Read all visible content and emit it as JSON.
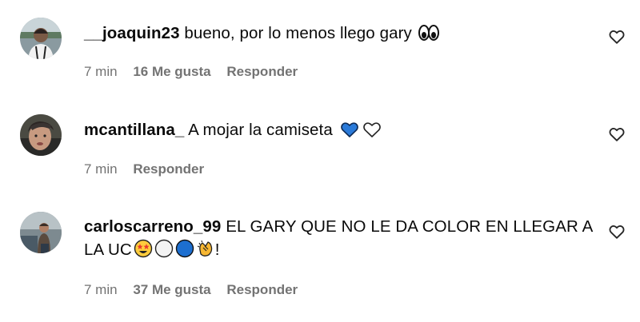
{
  "comments": [
    {
      "username": "__joaquin23",
      "text": "bueno, por lo menos llego gary",
      "emojis": [
        "eyes-emoji"
      ],
      "time": "7 min",
      "likes": "16 Me gusta",
      "reply": "Responder"
    },
    {
      "username": "mcantillana_",
      "text": "A mojar la camiseta",
      "emojis": [
        "blue-heart-emoji",
        "white-heart-emoji"
      ],
      "time": "7 min",
      "likes": "",
      "reply": "Responder"
    },
    {
      "username": "carloscarreno_99",
      "text": "EL GARY QUE NO LE DA COLOR EN LLEGAR A LA UC",
      "emojis": [
        "star-struck-emoji",
        "white-circle-emoji",
        "blue-circle-emoji",
        "clapping-hands-emoji"
      ],
      "suffix": "!",
      "time": "7 min",
      "likes": "37 Me gusta",
      "reply": "Responder"
    }
  ],
  "colors": {
    "meta_text": "#737373",
    "text": "#0a0a0a",
    "heart_stroke": "#262626",
    "blue": "#1d6fd0"
  },
  "icons": [
    "like-heart-icon"
  ]
}
